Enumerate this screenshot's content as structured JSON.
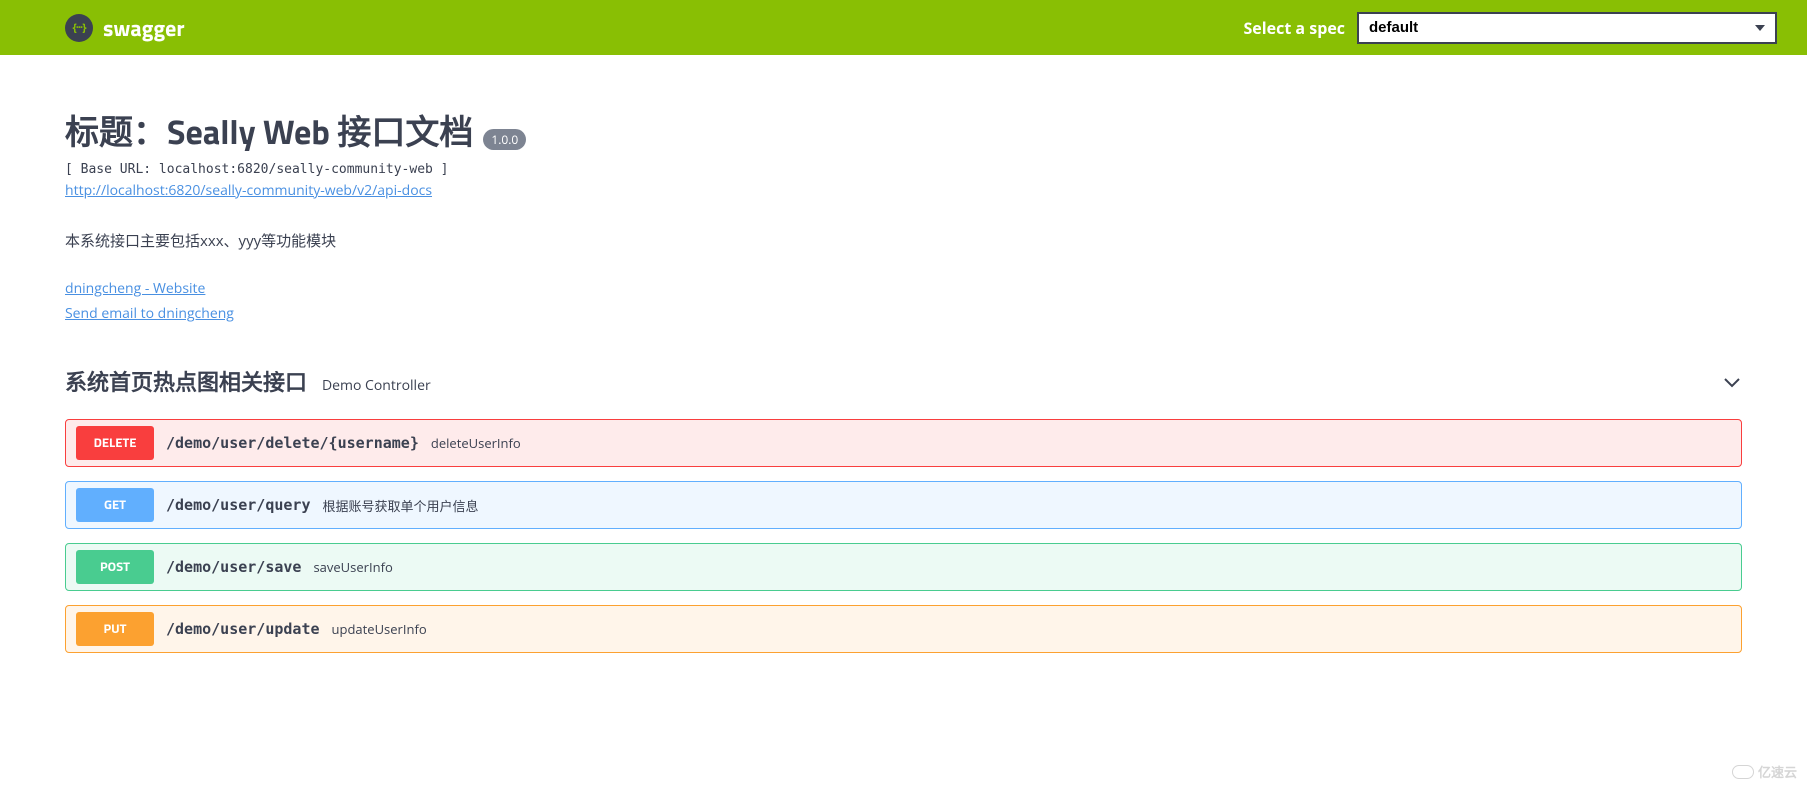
{
  "topbar": {
    "brand": "swagger",
    "spec_label": "Select a spec",
    "spec_value": "default"
  },
  "info": {
    "title": "标题：Seally Web 接口文档",
    "version": "1.0.0",
    "base_url_label": "[ Base URL: localhost:6820/seally-community-web ]",
    "api_docs_url": "http://localhost:6820/seally-community-web/v2/api-docs",
    "description": "本系统接口主要包括xxx、yyy等功能模块",
    "contact_website": "dningcheng - Website",
    "contact_email": "Send email to dningcheng"
  },
  "tag": {
    "name": "系统首页热点图相关接口",
    "description": "Demo Controller"
  },
  "operations": [
    {
      "method": "DELETE",
      "path": "/demo/user/delete/{username}",
      "summary": "deleteUserInfo",
      "css": "delete"
    },
    {
      "method": "GET",
      "path": "/demo/user/query",
      "summary": "根据账号获取单个用户信息",
      "css": "get"
    },
    {
      "method": "POST",
      "path": "/demo/user/save",
      "summary": "saveUserInfo",
      "css": "post"
    },
    {
      "method": "PUT",
      "path": "/demo/user/update",
      "summary": "updateUserInfo",
      "css": "put"
    }
  ],
  "watermark": "亿速云"
}
